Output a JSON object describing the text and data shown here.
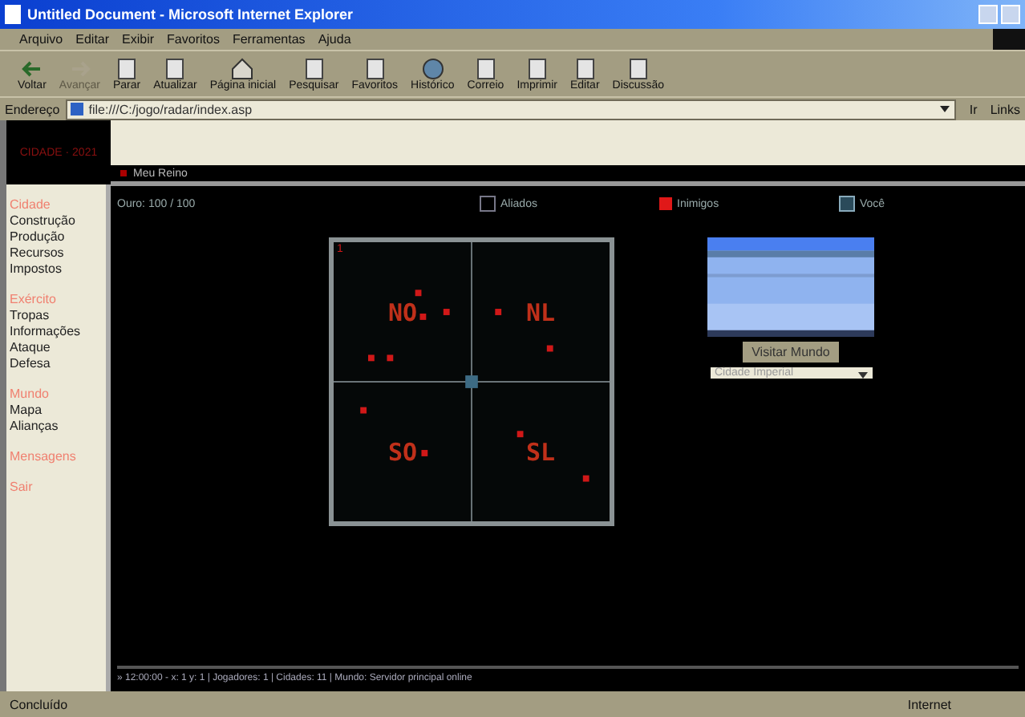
{
  "window": {
    "title": "Untitled Document - Microsoft Internet Explorer"
  },
  "menu": [
    "Arquivo",
    "Editar",
    "Exibir",
    "Favoritos",
    "Ferramentas",
    "Ajuda"
  ],
  "toolbar": [
    {
      "label": "Voltar",
      "disabled": false,
      "kind": "back"
    },
    {
      "label": "Avançar",
      "disabled": true,
      "kind": "forward"
    },
    {
      "label": "Parar",
      "disabled": false,
      "kind": "page"
    },
    {
      "label": "Atualizar",
      "disabled": false,
      "kind": "page"
    },
    {
      "label": "Página inicial",
      "disabled": false,
      "kind": "home"
    },
    {
      "label": "Pesquisar",
      "disabled": false,
      "kind": "page"
    },
    {
      "label": "Favoritos",
      "disabled": false,
      "kind": "page"
    },
    {
      "label": "Histórico",
      "disabled": false,
      "kind": "globe"
    },
    {
      "label": "Correio",
      "disabled": false,
      "kind": "page"
    },
    {
      "label": "Imprimir",
      "disabled": false,
      "kind": "page"
    },
    {
      "label": "Editar",
      "disabled": false,
      "kind": "page"
    },
    {
      "label": "Discussão",
      "disabled": false,
      "kind": "page"
    }
  ],
  "address": {
    "label": "Endereço",
    "value": "file:///C:/jogo/radar/index.asp",
    "go": "Ir",
    "links": "Links"
  },
  "site": {
    "logo": "CIDADE · 2021",
    "breadcrumb": "Meu Reino",
    "info": "Ouro: 100 / 100",
    "legend": [
      {
        "label": "Aliados",
        "kind": "empty"
      },
      {
        "label": "Inimigos",
        "kind": "red"
      },
      {
        "label": "Você",
        "kind": "blue"
      }
    ]
  },
  "sidebar": [
    {
      "title": "Cidade",
      "items": [
        "Construção",
        "Produção",
        "Recursos",
        "Impostos"
      ]
    },
    {
      "title": "Exército",
      "items": [
        "Tropas",
        "Informações",
        "Ataque",
        "Defesa"
      ]
    },
    {
      "title": "Mundo",
      "items": [
        "Mapa",
        "Alianças"
      ]
    },
    {
      "title": "Mensagens"
    },
    {
      "title": "Sair"
    }
  ],
  "radar": {
    "corner": "1",
    "quadrants": [
      "NO",
      "NL",
      "SO",
      "SL"
    ]
  },
  "panel": {
    "button": "Visitar Mundo",
    "select": "Cidade Imperial"
  },
  "console": "» 12:00:00 - x: 1 y: 1 | Jogadores: 1 | Cidades: 11 | Mundo: Servidor principal online",
  "status": {
    "text": "Concluído",
    "zone": "Internet"
  }
}
